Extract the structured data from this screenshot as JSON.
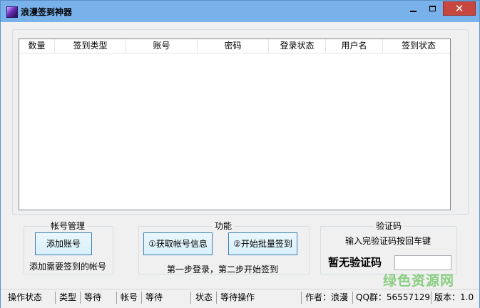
{
  "window": {
    "title": "浪漫签到神器",
    "icon": "app-gem-icon",
    "controls": [
      "minimize-icon",
      "maximize-icon",
      "close-icon"
    ],
    "close_glyph": "✕"
  },
  "listview": {
    "columns": [
      "数量",
      "签到类型",
      "账号",
      "密码",
      "登录状态",
      "用户名",
      "签到状态"
    ]
  },
  "account_group": {
    "title": "帐号管理",
    "add_button": "添加账号",
    "hint": "添加需要签到的帐号"
  },
  "function_group": {
    "title": "功能",
    "fetch_button": "①获取帐号信息",
    "batch_button": "②开始批量签到",
    "hint": "第一步登录，第二步开始签到"
  },
  "captcha_group": {
    "title": "验证码",
    "hint": "输入完验证码按回车键",
    "status": "暂无验证码",
    "input_value": ""
  },
  "statusbar": {
    "op_label": "操作状态",
    "type_label": "类型",
    "type_value": "等待",
    "account_label": "帐号",
    "account_value": "等待",
    "status_label": "状态",
    "status_value": "等待操作",
    "author": "作者：浪漫",
    "qq": "QQ群：56557129",
    "version": "版本：1.0"
  },
  "watermark": "绿色资源网",
  "colors": {
    "titlebar": "#79b1ea",
    "close_button": "#c7463d",
    "window_bg": "#f0f0f0"
  }
}
